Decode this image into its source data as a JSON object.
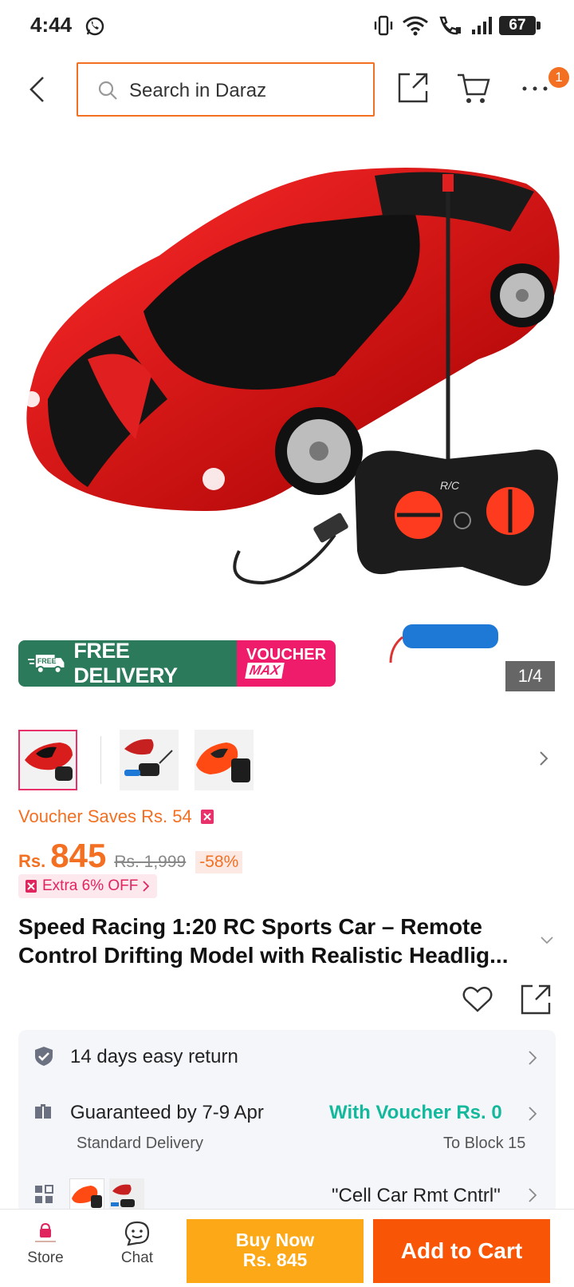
{
  "status_bar": {
    "time": "4:44",
    "battery": "67"
  },
  "header": {
    "search_placeholder": "Search in Daraz",
    "cart_badge": "1"
  },
  "gallery": {
    "promo_free_delivery": "FREE DELIVERY",
    "promo_free_tag": "FREE",
    "promo_voucher": "VOUCHER",
    "promo_max": "MAX",
    "counter": "1/4",
    "remote_label": "R/C"
  },
  "pricing": {
    "voucher_saves": "Voucher Saves Rs. 54",
    "currency": "Rs.",
    "price": "845",
    "original_price": "Rs. 1,999",
    "discount": "-58%",
    "extra_off": "Extra 6% OFF"
  },
  "product": {
    "title_line1": "Speed Racing 1:20 RC Sports Car – Remote",
    "title_line2": "Control Drifting Model with Realistic Headlig..."
  },
  "services": {
    "return": "14 days easy return",
    "delivery": "Guaranteed by 7-9 Apr",
    "delivery_type": "Standard Delivery",
    "voucher": "With Voucher Rs. 0",
    "location": "To Block 15",
    "variant": "\"Cell Car Rmt Cntrl\""
  },
  "bottom_bar": {
    "store": "Store",
    "chat": "Chat",
    "buy_now_line1": "Buy Now",
    "buy_now_line2": "Rs. 845",
    "add_to_cart": "Add to Cart"
  },
  "colors": {
    "accent": "#f36f21",
    "buy_now": "#fca817",
    "add_to_cart": "#f85606",
    "green": "#14b89c"
  }
}
